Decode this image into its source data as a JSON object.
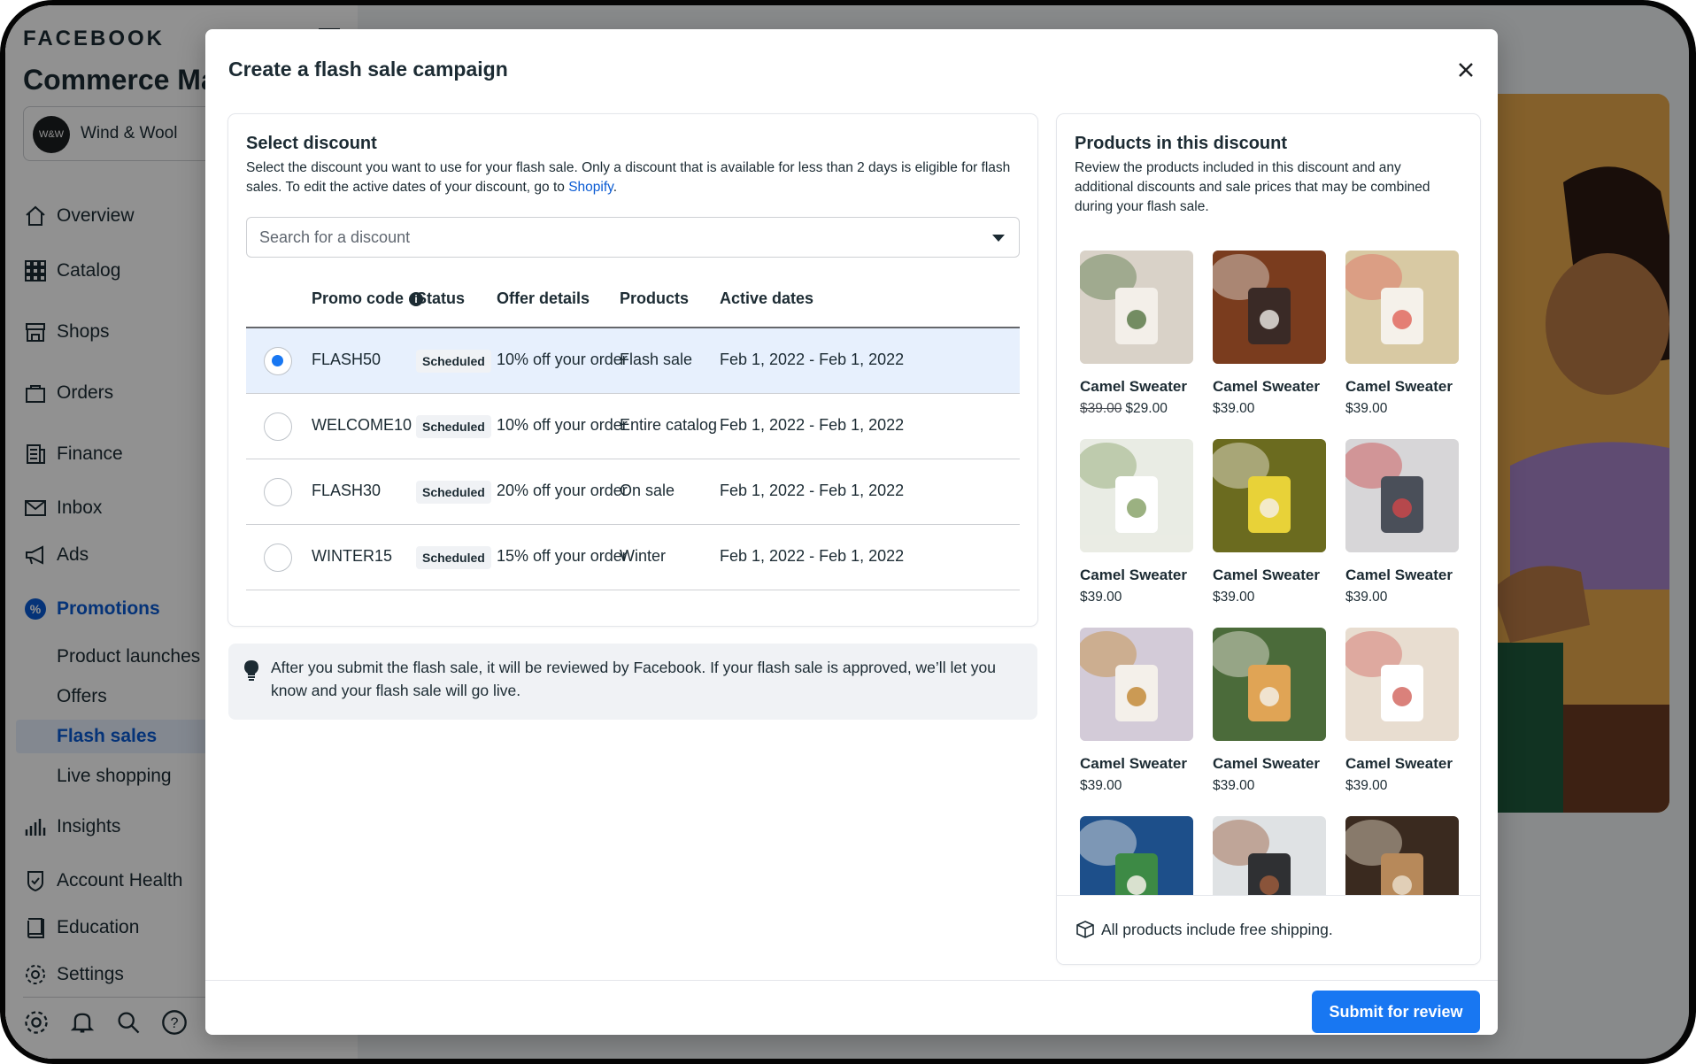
{
  "app": {
    "brand": "FACEBOOK",
    "title": "Commerce Ma",
    "shop": {
      "avatar_text": "W&W",
      "name": "Wind & Wool"
    },
    "nav": [
      {
        "label": "Overview",
        "icon": "home-icon"
      },
      {
        "label": "Catalog",
        "icon": "grid-icon"
      },
      {
        "label": "Shops",
        "icon": "storefront-icon"
      },
      {
        "label": "Orders",
        "icon": "shopping-bag-icon"
      },
      {
        "label": "Finance",
        "icon": "ledger-icon"
      },
      {
        "label": "Inbox",
        "icon": "mail-icon"
      },
      {
        "label": "Ads",
        "icon": "megaphone-icon"
      },
      {
        "label": "Promotions",
        "icon": "percent-badge-icon"
      },
      {
        "label": "Insights",
        "icon": "bar-chart-icon"
      },
      {
        "label": "Account Health",
        "icon": "shield-check-icon"
      },
      {
        "label": "Education",
        "icon": "book-icon"
      },
      {
        "label": "Settings",
        "icon": "gear-icon"
      }
    ],
    "promotions_sub": [
      "Product launches",
      "Offers",
      "Flash sales",
      "Live shopping"
    ],
    "active_sub": "Flash sales",
    "accent_color": "#0a5bd3"
  },
  "modal": {
    "title": "Create a flash sale campaign",
    "select_discount": {
      "title": "Select discount",
      "description": "Select the discount you want to use for your flash sale. Only a discount that is available for less than 2 days is eligible for flash sales. To edit the active dates of your discount, go to ",
      "link": "Shopify",
      "description_end": ".",
      "search_placeholder": "Search for a discount",
      "columns": {
        "promo": "Promo code",
        "status": "Status",
        "offer": "Offer details",
        "products": "Products",
        "dates": "Active dates"
      },
      "rows": [
        {
          "code": "FLASH50",
          "status": "Scheduled",
          "offer": "10% off your order",
          "products": "Flash sale",
          "dates": "Feb 1, 2022 - Feb 1, 2022",
          "selected": true
        },
        {
          "code": "WELCOME10",
          "status": "Scheduled",
          "offer": "10% off your order",
          "products": "Entire catalog",
          "dates": "Feb 1, 2022 - Feb 1, 2022",
          "selected": false
        },
        {
          "code": "FLASH30",
          "status": "Scheduled",
          "offer": "20% off your order",
          "products": "On sale",
          "dates": "Feb 1, 2022 - Feb 1, 2022",
          "selected": false
        },
        {
          "code": "WINTER15",
          "status": "Scheduled",
          "offer": "15% off your order",
          "products": "Winter",
          "dates": "Feb 1, 2022 - Feb 1, 2022",
          "selected": false
        }
      ]
    },
    "notice": "After you submit the flash sale, it will be reviewed by Facebook. If your flash sale is approved, we’ll let you know and your flash sale will go live.",
    "products": {
      "title": "Products in this discount",
      "description": "Review the products included in this discount and any additional discounts and sale prices that may be combined during your flash sale.",
      "items": [
        {
          "name": "Camel Sweater",
          "old_price": "$39.00",
          "price": "$29.00",
          "image": "woman-in-white-coat",
          "colors": [
            "#d9d2c8",
            "#f3efe9",
            "#5c7a4a"
          ]
        },
        {
          "name": "Camel Sweater",
          "old_price": "",
          "price": "$39.00",
          "image": "serum-bottle",
          "colors": [
            "#7a3c1e",
            "#3a2a26",
            "#e5e1dc"
          ]
        },
        {
          "name": "Camel Sweater",
          "old_price": "",
          "price": "$39.00",
          "image": "candle-with-flowers",
          "colors": [
            "#d8c9a3",
            "#f5f1ea",
            "#e06a5f"
          ]
        },
        {
          "name": "Camel Sweater",
          "old_price": "",
          "price": "$39.00",
          "image": "white-candles",
          "colors": [
            "#e9ece4",
            "#ffffff",
            "#8aa36b"
          ]
        },
        {
          "name": "Camel Sweater",
          "old_price": "",
          "price": "$39.00",
          "image": "candle-in-mimosa",
          "colors": [
            "#6b6b1f",
            "#e8d238",
            "#f4efe3"
          ]
        },
        {
          "name": "Camel Sweater",
          "old_price": "",
          "price": "$39.00",
          "image": "lipstick",
          "colors": [
            "#d7d6d8",
            "#4a4f59",
            "#c9474a"
          ]
        },
        {
          "name": "Camel Sweater",
          "old_price": "",
          "price": "$39.00",
          "image": "skincare-bottles",
          "colors": [
            "#d3cbd8",
            "#f4f0ea",
            "#c38b3a"
          ]
        },
        {
          "name": "Camel Sweater",
          "old_price": "",
          "price": "$39.00",
          "image": "candle-with-books",
          "colors": [
            "#4b6b3a",
            "#e0a455",
            "#f2eee5"
          ]
        },
        {
          "name": "Camel Sweater",
          "old_price": "",
          "price": "$39.00",
          "image": "candle-dried-flowers",
          "colors": [
            "#e8ddd0",
            "#ffffff",
            "#d36b64"
          ]
        },
        {
          "name": "",
          "old_price": "",
          "price": "",
          "image": "candle-on-blue",
          "colors": [
            "#1d4f8a",
            "#3d8a45",
            "#f5f0e8"
          ]
        },
        {
          "name": "",
          "old_price": "",
          "price": "",
          "image": "hair-trimmers",
          "colors": [
            "#dfe2e4",
            "#2f3033",
            "#9a5b3c"
          ]
        },
        {
          "name": "",
          "old_price": "",
          "price": "",
          "image": "coffee-dripper",
          "colors": [
            "#3a2a1f",
            "#b7895a",
            "#e9dcc8"
          ]
        }
      ],
      "shipping": "All products include free shipping."
    },
    "submit_label": "Submit for review",
    "primary_color": "#1877f2"
  }
}
